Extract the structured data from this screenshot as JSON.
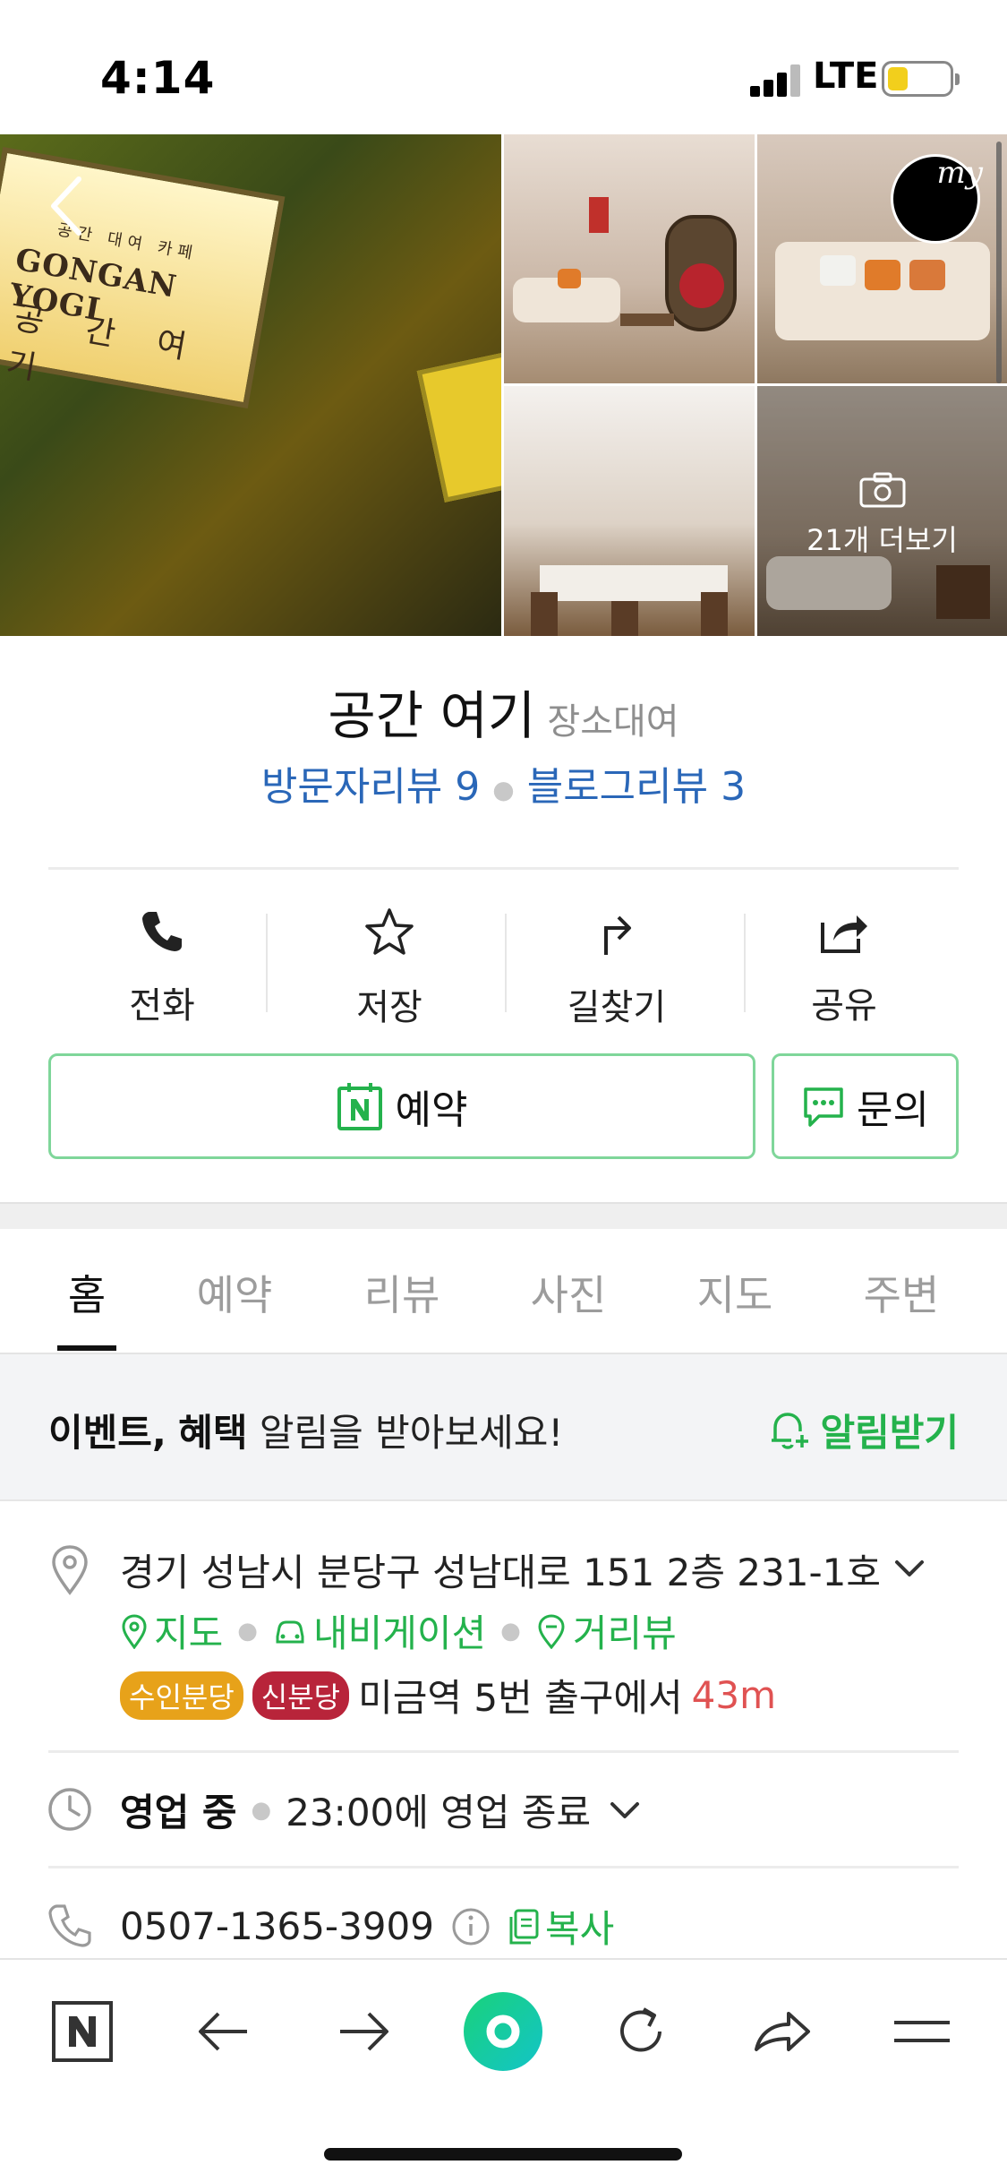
{
  "status_bar": {
    "time": "4:14",
    "network": "LTE"
  },
  "gallery": {
    "sign_small": "공간 대여 카페",
    "sign_title": "GONGAN YOGI",
    "sign_korean": "공 간 여 기",
    "more_label": "21개 더보기",
    "badge_label": "my"
  },
  "place": {
    "name": "공간 여기",
    "category": "장소대여",
    "visitor_reviews": "방문자리뷰 9",
    "blog_reviews": "블로그리뷰 3"
  },
  "actions": [
    {
      "label": "전화",
      "icon": "phone-icon"
    },
    {
      "label": "저장",
      "icon": "star-icon"
    },
    {
      "label": "길찾기",
      "icon": "directions-icon"
    },
    {
      "label": "공유",
      "icon": "share-icon"
    }
  ],
  "booking": {
    "reserve_label": "예약",
    "inquiry_label": "문의"
  },
  "tabs": [
    "홈",
    "예약",
    "리뷰",
    "사진",
    "지도",
    "주변"
  ],
  "event": {
    "bold1": "이벤트,",
    "bold2": "혜택",
    "text": "알림을 받아보세요!",
    "cta": "알림받기"
  },
  "info": {
    "address": "경기 성남시 분당구 성남대로 151 2층 231-1호",
    "links": [
      "지도",
      "내비게이션",
      "거리뷰"
    ],
    "subway": {
      "lines": [
        {
          "name": "수인분당",
          "color": "#e7a21a"
        },
        {
          "name": "신분당",
          "color": "#b8243a"
        }
      ],
      "station_text": "미금역 5번 출구에서",
      "distance": "43m"
    },
    "hours_status": "영업 중",
    "hours_text": "23:00에 영업 종료",
    "phone": "0507-1365-3909",
    "copy_label": "복사"
  },
  "toolbar": [
    "naver-home-icon",
    "back-arrow-icon",
    "forward-arrow-icon",
    "green-dot-icon",
    "refresh-icon",
    "share-arrow-icon",
    "menu-icon"
  ],
  "colors": {
    "accent_green": "#24b24c",
    "link_blue": "#2a67b8",
    "distance_red": "#e05252"
  }
}
